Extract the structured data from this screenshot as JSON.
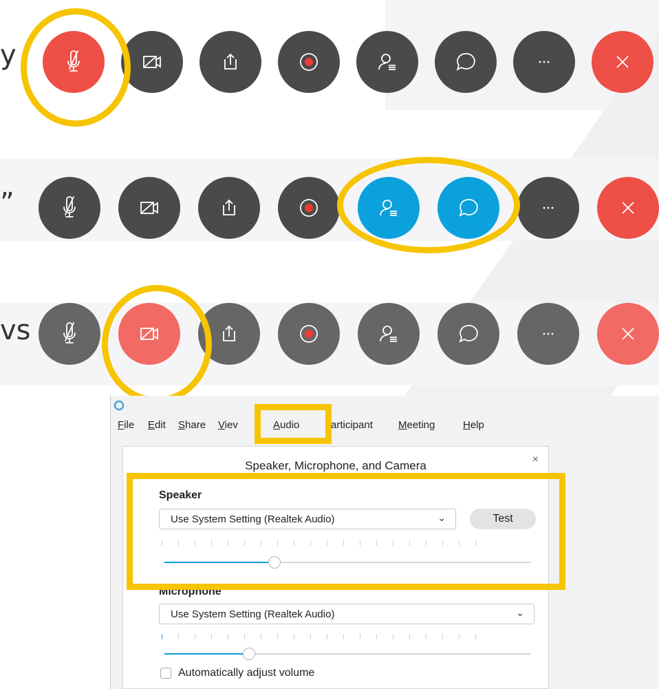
{
  "left_text": {
    "row1": "y",
    "row2": "”",
    "row3": "vs"
  },
  "toolbar_rows": [
    {
      "state": "muted",
      "highlight": "mute-button"
    },
    {
      "state": "panels-active",
      "highlight": "participants-and-chat"
    },
    {
      "state": "video-off",
      "highlight": "video-button"
    }
  ],
  "icons": [
    "microphone-muted-icon",
    "video-off-icon",
    "share-icon",
    "record-icon",
    "participants-icon",
    "chat-icon",
    "more-icon",
    "end-call-icon"
  ],
  "colors": {
    "highlight": "#f6c400",
    "button_dark": "#4a4a4a",
    "button_red": "#ee4f47",
    "button_blue": "#0aa1dd"
  },
  "window": {
    "menu": [
      {
        "label": "File",
        "key": "F"
      },
      {
        "label": "Edit",
        "key": "E"
      },
      {
        "label": "Share",
        "key": "S"
      },
      {
        "label": "Viev",
        "key": "V"
      },
      {
        "label": "Audio",
        "key": "A"
      },
      {
        "label": "articipant",
        "key": ""
      },
      {
        "label": "Meeting",
        "key": "M"
      },
      {
        "label": "Help",
        "key": "H"
      }
    ]
  },
  "dialog": {
    "title": "Speaker, Microphone, and Camera",
    "close": "×",
    "speaker": {
      "label": "Speaker",
      "device": "Use System Setting (Realtek Audio)",
      "test_label": "Test",
      "volume": 0.3
    },
    "microphone": {
      "label": "Microphone",
      "device": "Use System Setting (Realtek Audio)",
      "volume": 0.23
    },
    "auto_adjust_label": "Automatically adjust volume"
  }
}
